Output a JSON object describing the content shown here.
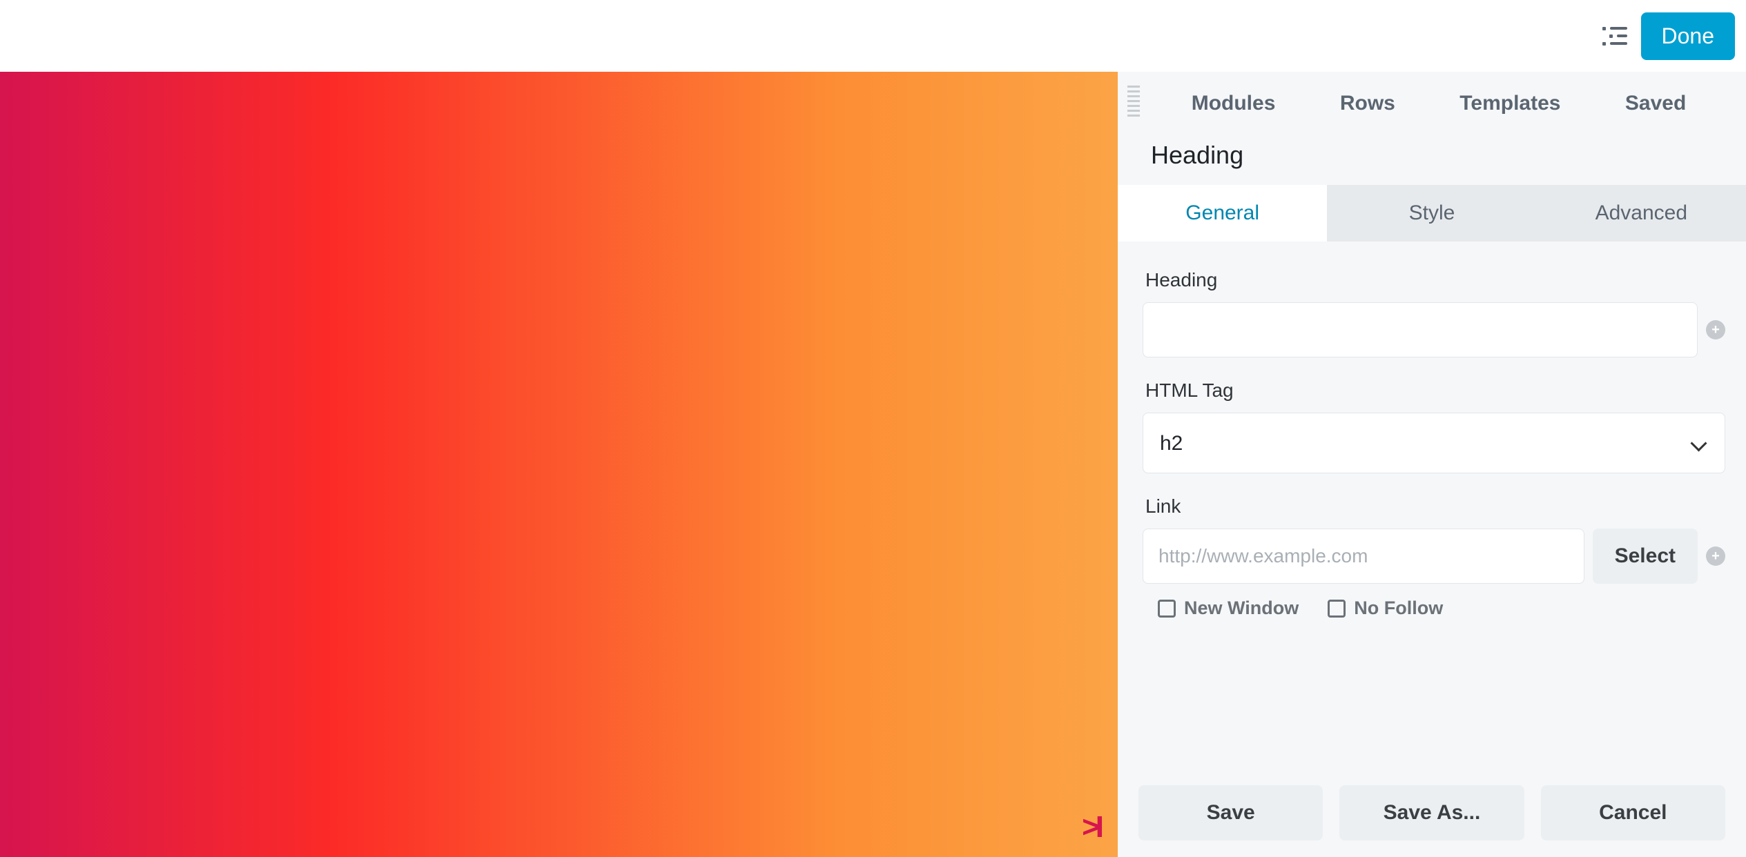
{
  "topbar": {
    "done_label": "Done"
  },
  "panel": {
    "top_tabs": [
      "Modules",
      "Rows",
      "Templates",
      "Saved"
    ],
    "module_title": "Heading",
    "sub_tabs": {
      "general": "General",
      "style": "Style",
      "advanced": "Advanced"
    },
    "fields": {
      "heading_label": "Heading",
      "heading_value": "",
      "html_tag_label": "HTML Tag",
      "html_tag_value": "h2",
      "link_label": "Link",
      "link_value": "",
      "link_placeholder": "http://www.example.com",
      "select_btn": "Select",
      "new_window_label": "New Window",
      "no_follow_label": "No Follow"
    },
    "footer": {
      "save": "Save",
      "save_as": "Save As...",
      "cancel": "Cancel"
    }
  }
}
